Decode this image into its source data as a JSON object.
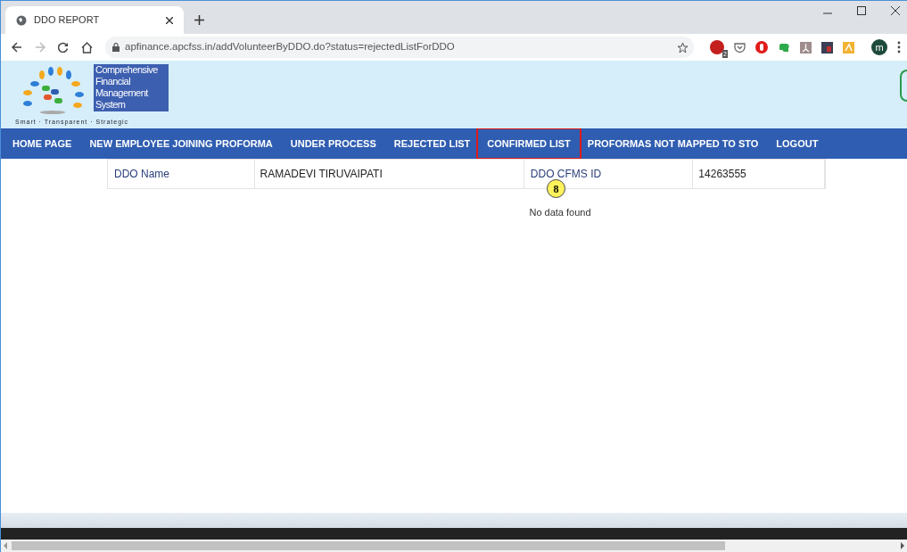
{
  "browser": {
    "tab_title": "DDO REPORT",
    "url": "apfinance.apcfss.in/addVolunteerByDDO.do?status=rejectedListForDDO",
    "adblock_count": "2",
    "profile_initial": "m"
  },
  "logo": {
    "lines": [
      "Comprehensive",
      "Financial",
      "Management",
      "System"
    ],
    "tagline": "Smart · Transparent · Strategic"
  },
  "nav": [
    {
      "label": "HOME PAGE",
      "highlighted": false
    },
    {
      "label": "NEW EMPLOYEE JOINING PROFORMA",
      "highlighted": false
    },
    {
      "label": "UNDER PROCESS",
      "highlighted": false
    },
    {
      "label": "REJECTED LIST",
      "highlighted": false
    },
    {
      "label": "CONFIRMED LIST",
      "highlighted": true
    },
    {
      "label": "PROFORMAS NOT MAPPED TO STO",
      "highlighted": false
    },
    {
      "label": "LOGOUT",
      "highlighted": false
    }
  ],
  "details": [
    {
      "label": "DDO Name",
      "value": "RAMADEVI TIRUVAIPATI"
    },
    {
      "label": "DDO CFMS ID",
      "value": "14263555"
    }
  ],
  "message": "No data found",
  "callout": "8"
}
